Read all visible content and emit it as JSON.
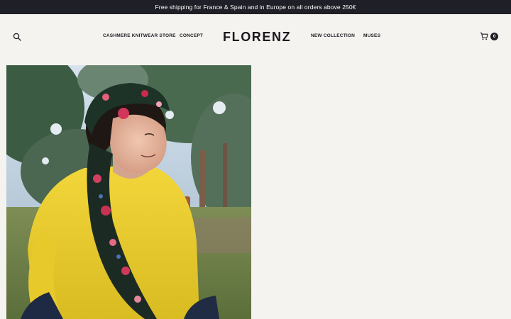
{
  "announcement": "Free shipping for France & Spain and in Europe on all orders above 250€",
  "logo": "FLORENZ",
  "nav": {
    "cashmere": "CASHMERE KNITWEAR STORE",
    "concept": "CONCEPT",
    "new_collection": "NEW COLLECTION",
    "muses": "MUSES"
  },
  "cart": {
    "count": "0"
  },
  "colors": {
    "announcement_bg": "#1f1f27",
    "page_bg": "#f5f3ef",
    "text": "#1e1e24"
  },
  "icons": {
    "search": "search-icon",
    "cart": "cart-icon"
  }
}
